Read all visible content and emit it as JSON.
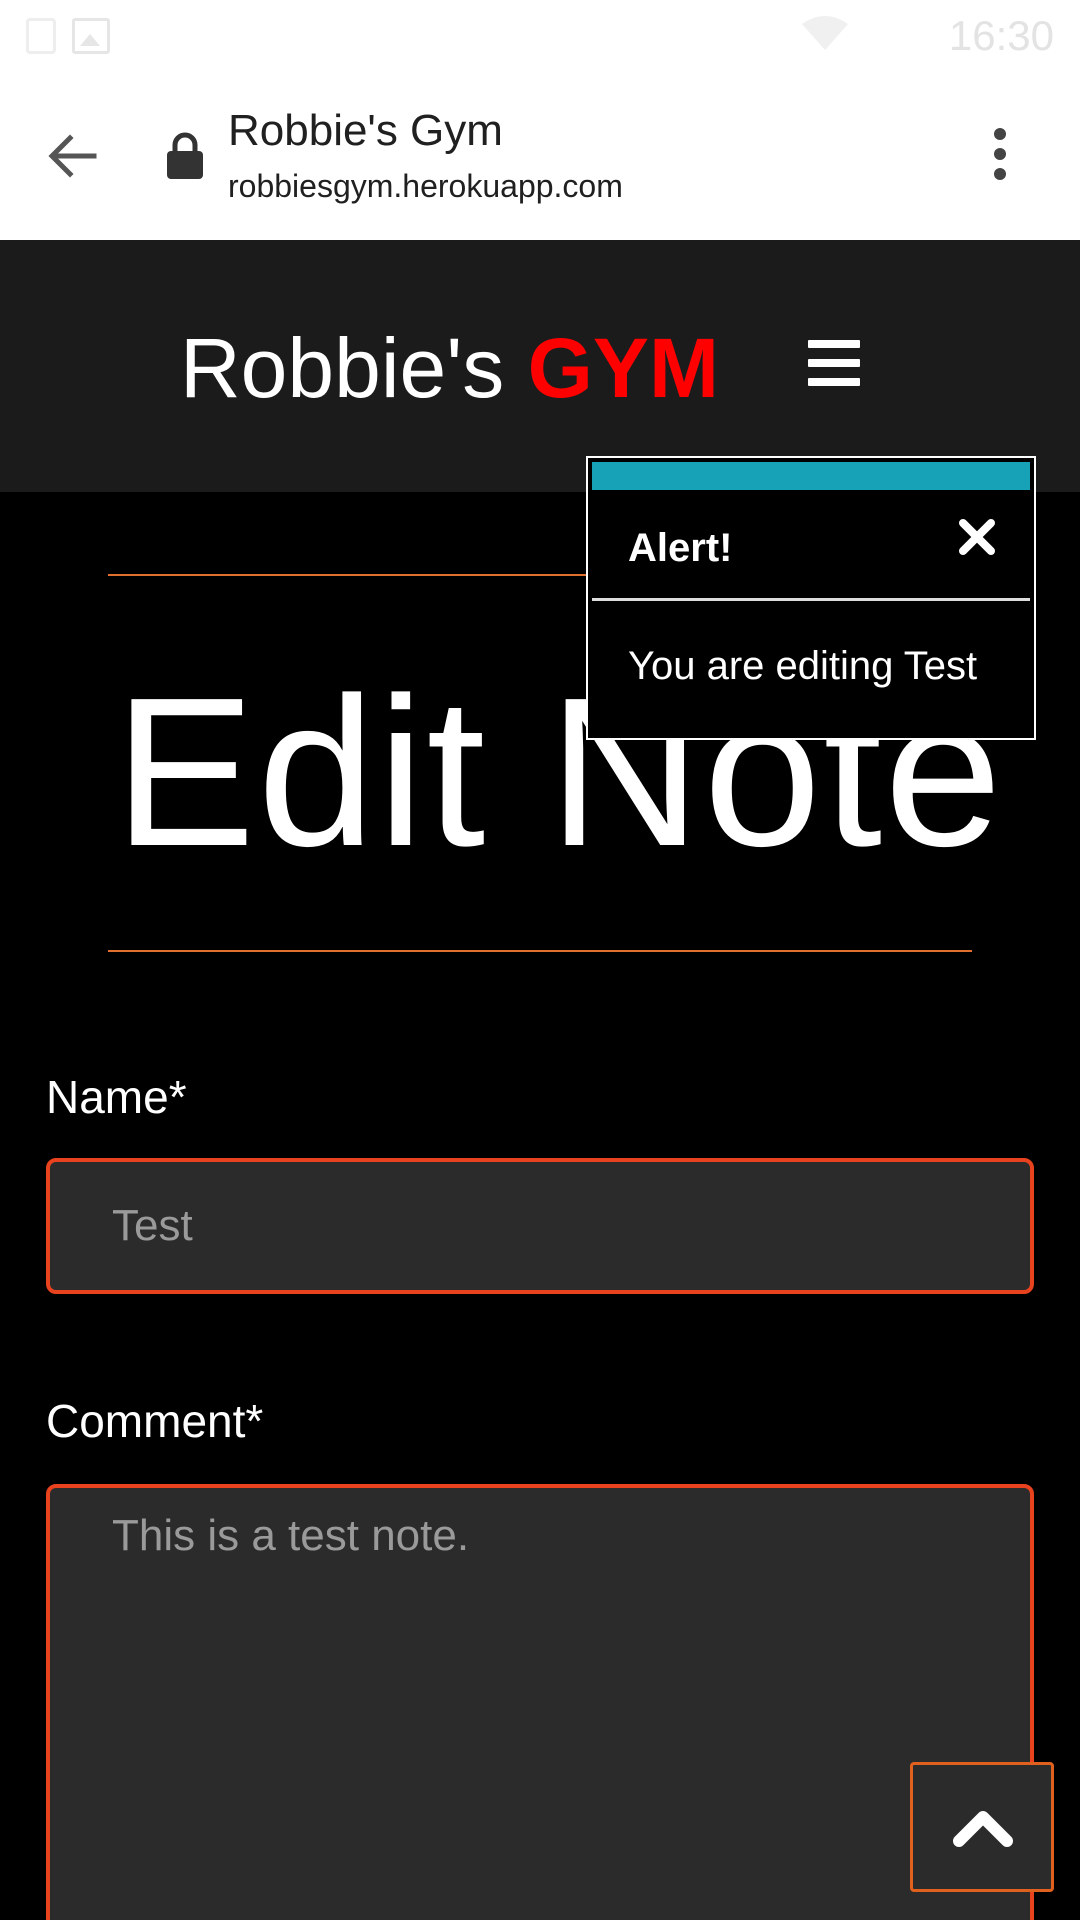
{
  "status_bar": {
    "time": "16:30",
    "icons": [
      "sim-icon",
      "image-icon",
      "wifi-icon"
    ]
  },
  "browser": {
    "page_title": "Robbie's Gym",
    "url": "robbiesgym.herokuapp.com",
    "icons": [
      "back-arrow-icon",
      "lock-icon",
      "more-vert-icon"
    ]
  },
  "site_header": {
    "brand_prefix": "Robbie's",
    "brand_accent": "GYM",
    "accent_color": "#ff0000",
    "menu_icon": "hamburger-icon"
  },
  "main": {
    "heading": "Edit Note",
    "fields": {
      "name_label": "Name*",
      "name_value": "Test",
      "comment_label": "Comment*",
      "comment_value": "This is a test note."
    },
    "border_color": "#e8421e"
  },
  "alert": {
    "title": "Alert!",
    "message": "You are editing Test",
    "bar_color": "#17a2b8",
    "close_icon": "close-icon"
  },
  "back_to_top": {
    "icon": "chevron-up-icon"
  }
}
